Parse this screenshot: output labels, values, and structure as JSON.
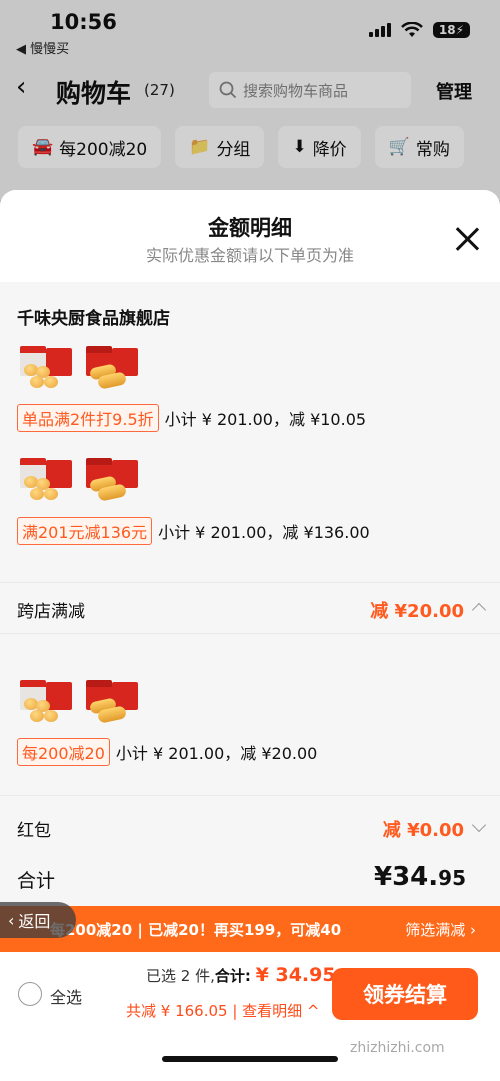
{
  "status": {
    "time": "10:56",
    "back_app": "◀ 慢慢买",
    "battery": "18"
  },
  "nav": {
    "back": "‹",
    "title": "购物车",
    "count": "(27)",
    "search_placeholder": "搜索购物车商品",
    "manage": "管理"
  },
  "chips": [
    {
      "icon": "🚘",
      "label": "每200减20"
    },
    {
      "icon": "📁",
      "label": "分组"
    },
    {
      "icon": "⬇",
      "label": "降价"
    },
    {
      "icon": "🛒",
      "label": "常购"
    }
  ],
  "sheet": {
    "title": "金额明细",
    "subtitle": "实际优惠金额请以下单页为准",
    "store": {
      "name": "千味央厨食品旗舰店",
      "promos": [
        {
          "tag": "单品满2件打9.5折",
          "text": "小计 ¥ 201.00，减 ¥10.05"
        },
        {
          "tag": "满201元减136元",
          "text": "小计 ¥ 201.00，减 ¥136.00"
        }
      ]
    },
    "cross_store": {
      "label": "跨店满减",
      "value": "减 ¥20.00",
      "promo": {
        "tag": "每200减20",
        "text": "小计 ¥ 201.00，减 ¥20.00"
      }
    },
    "hongbao": {
      "label": "红包",
      "value": "减 ¥0.00"
    },
    "total": {
      "label": "合计",
      "value": "¥34.",
      "value_small": "95"
    }
  },
  "orange_bar": {
    "text": "每200减20 | 已减20！再买199，可减40",
    "link": "筛选满减 ›"
  },
  "back_pill": "返回",
  "bottom": {
    "select_all": "全选",
    "selected": "已选 2 件,",
    "total_label": "合计:",
    "total_amount": "¥ 34.95",
    "saved": "共减 ¥ 166.05 | 查看明细 ^",
    "checkout": "领券结算"
  },
  "watermark": "zhizhizhi.com",
  "colors": {
    "accent": "#ff5a1a",
    "tag_border": "#ff6a3d",
    "bar": "#ff6a1a"
  }
}
